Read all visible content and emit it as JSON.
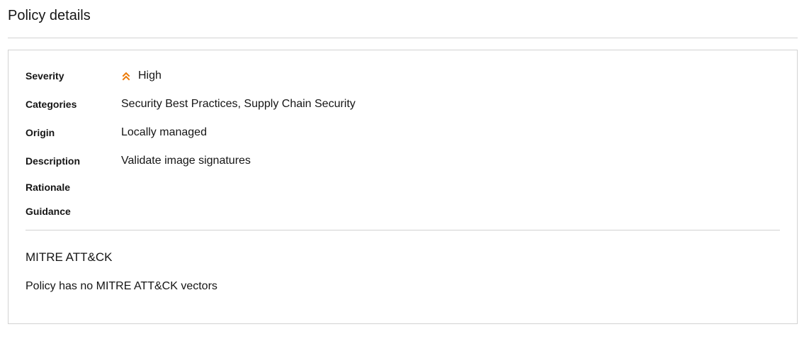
{
  "page": {
    "title": "Policy details"
  },
  "details": {
    "severity": {
      "label": "Severity",
      "value": "High",
      "icon": "angle-double-up-icon",
      "icon_color": "#ec7a08"
    },
    "categories": {
      "label": "Categories",
      "value": "Security Best Practices, Supply Chain Security"
    },
    "origin": {
      "label": "Origin",
      "value": "Locally managed"
    },
    "description": {
      "label": "Description",
      "value": "Validate image signatures"
    },
    "rationale": {
      "label": "Rationale",
      "value": ""
    },
    "guidance": {
      "label": "Guidance",
      "value": ""
    }
  },
  "mitre": {
    "title": "MITRE ATT&CK",
    "empty_text": "Policy has no MITRE ATT&CK vectors"
  },
  "colors": {
    "text": "#151515",
    "border": "#d2d2d2",
    "severity_high": "#ec7a08"
  }
}
